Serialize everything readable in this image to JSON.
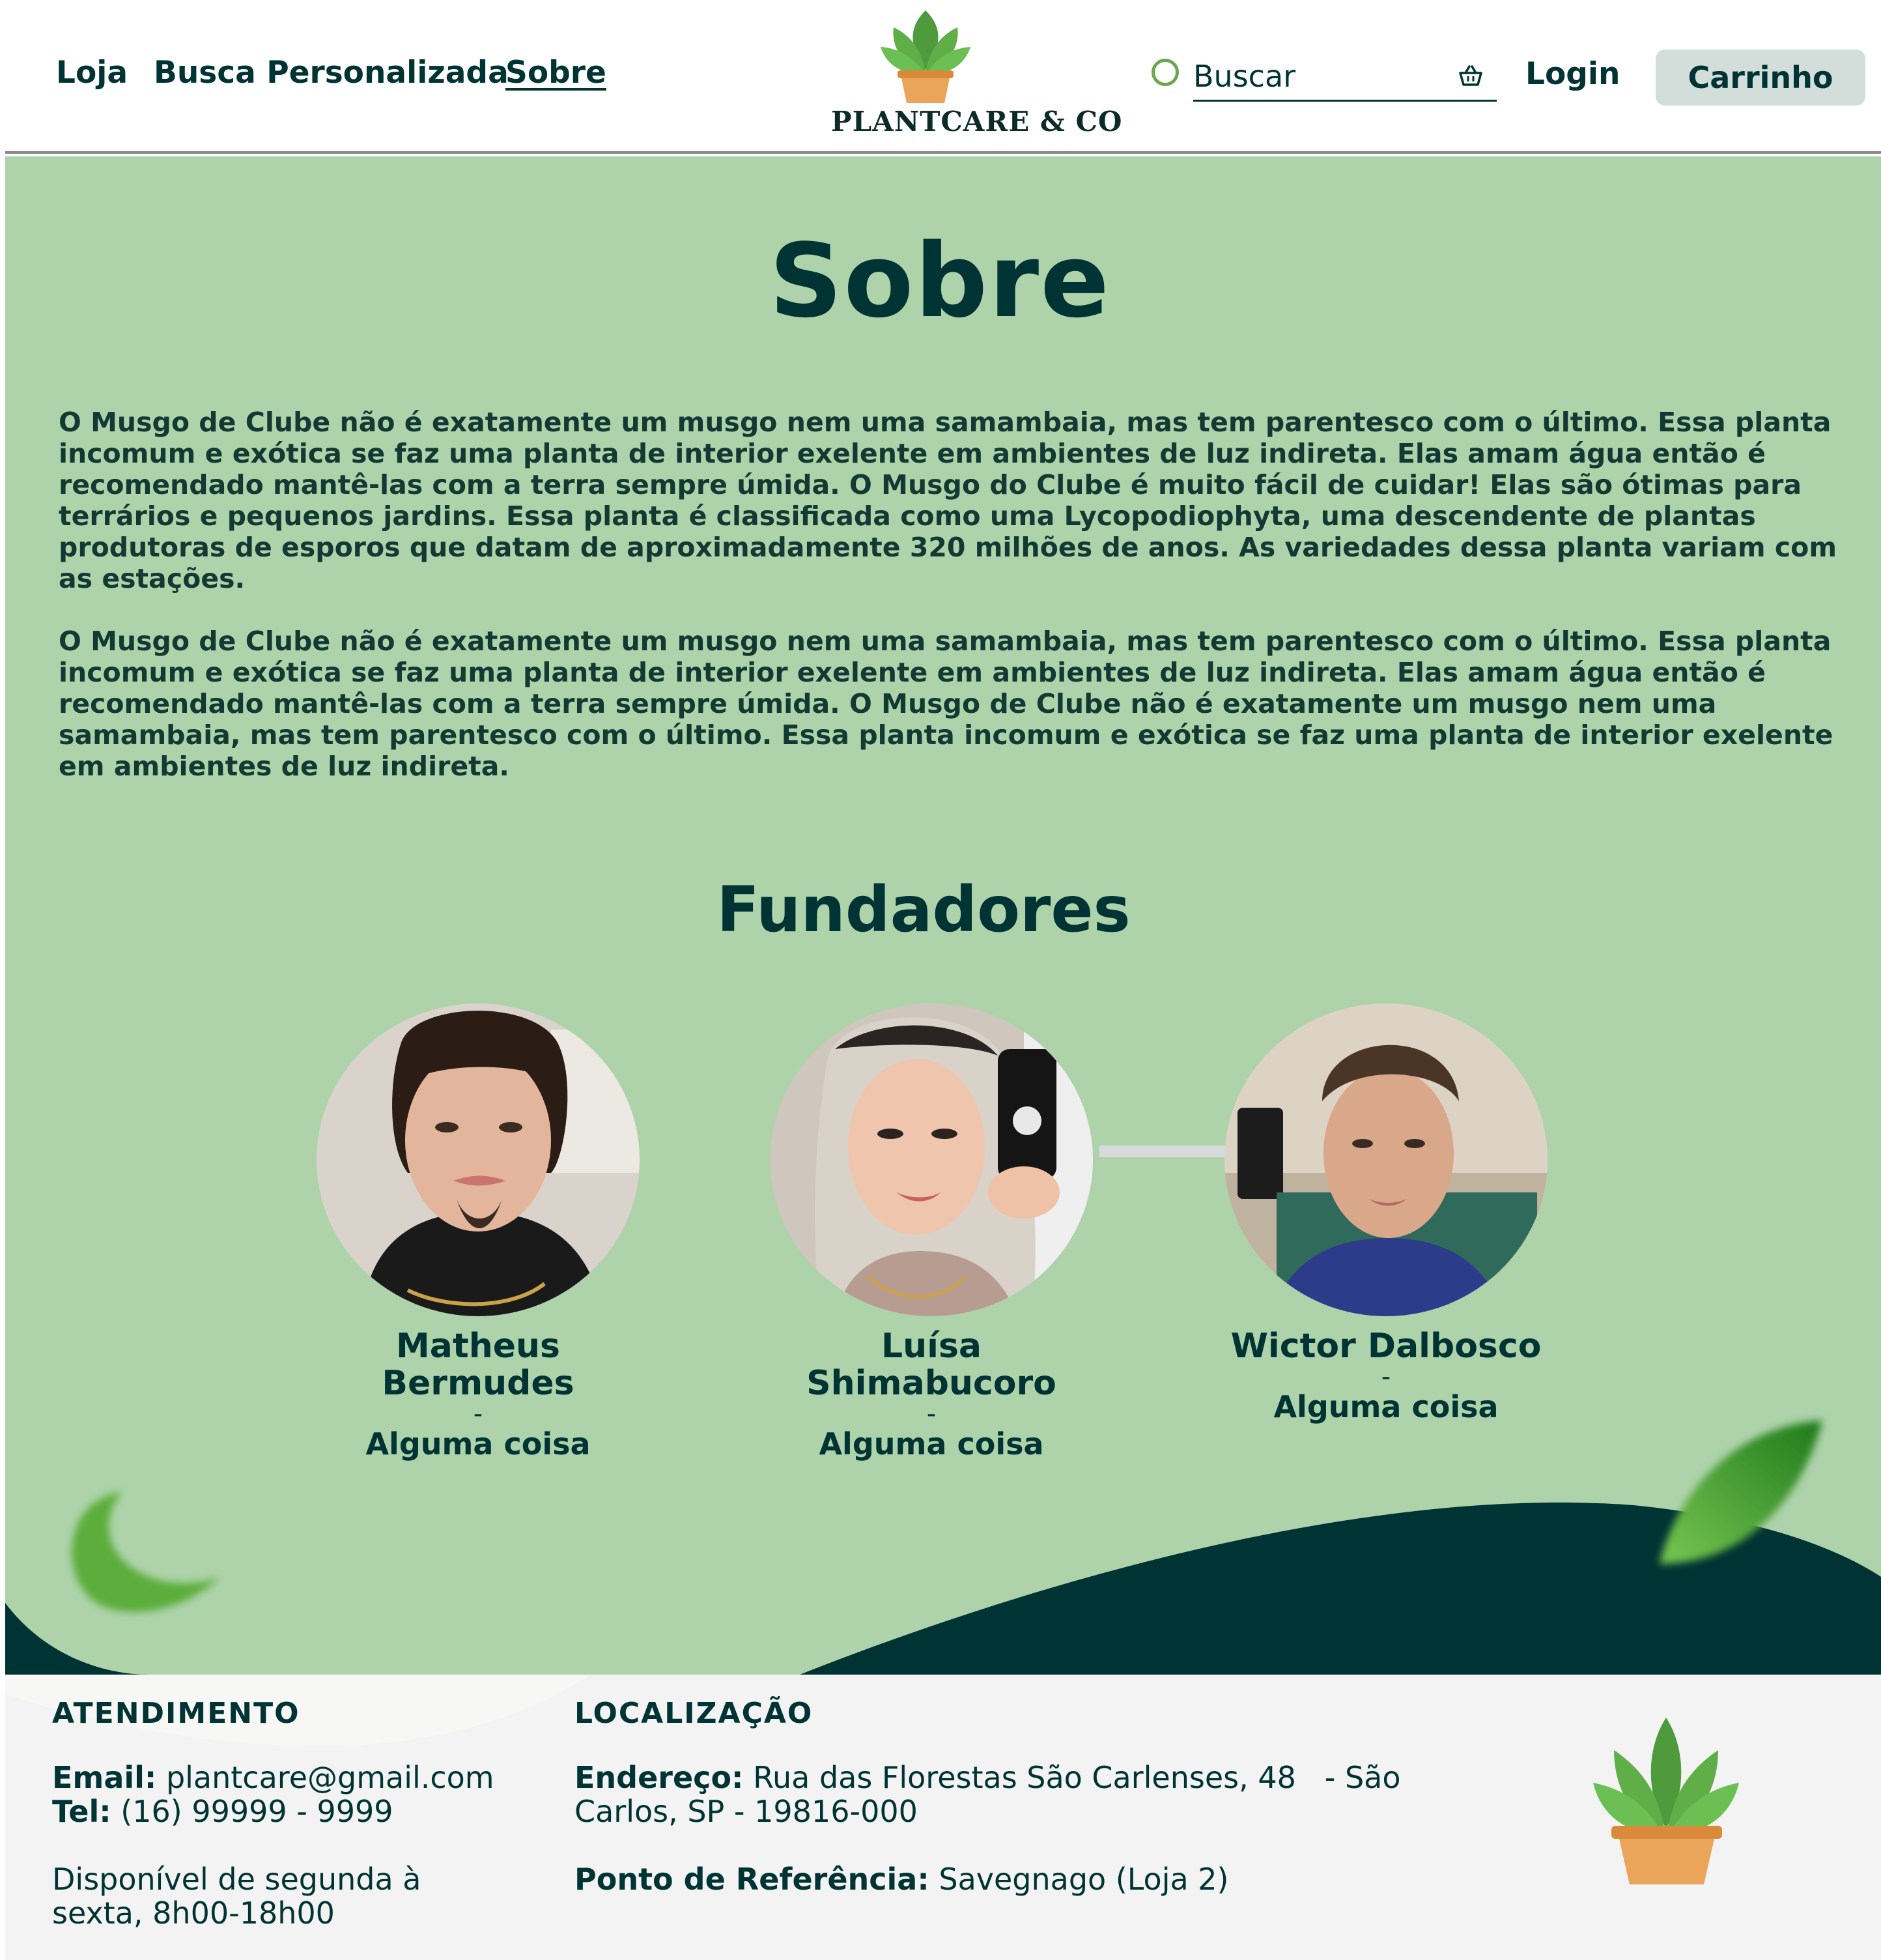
{
  "header": {
    "nav": [
      {
        "label": "Loja"
      },
      {
        "label": "Busca Personalizada"
      },
      {
        "label": "Sobre"
      }
    ],
    "logo_text": "PLANTCARE & CO",
    "search": {
      "placeholder": "Buscar"
    },
    "login_label": "Login",
    "cart_label": "Carrinho"
  },
  "main": {
    "title": "Sobre",
    "paragraphs": [
      "O Musgo de Clube não é exatamente um musgo nem uma samambaia, mas tem parentesco com o último. Essa planta incomum e exótica se faz uma planta de interior exelente em ambientes de luz indireta. Elas amam água então é recomendado mantê-las com a terra sempre úmida. O Musgo do Clube é muito fácil de cuidar! Elas são ótimas para terrários e pequenos jardins. Essa planta é classificada como uma Lycopodiophyta, uma descendente de plantas produtoras de esporos que datam de aproximadamente 320 milhões de anos. As variedades dessa planta variam com as estações.",
      "O Musgo de Clube não é exatamente um musgo nem uma samambaia, mas tem parentesco com o último. Essa planta incomum e exótica se faz uma planta de interior exelente em ambientes de luz indireta. Elas amam água então é recomendado mantê-las com a terra sempre úmida. O Musgo de Clube não é exatamente um musgo nem uma samambaia, mas tem parentesco com o último. Essa planta incomum e exótica se faz uma planta de interior exelente em ambientes de luz indireta."
    ],
    "founders_title": "Fundadores",
    "founders": [
      {
        "name": "Matheus Bermudes",
        "dash": "-",
        "role": "Alguma coisa"
      },
      {
        "name": "Luísa Shimabucoro",
        "dash": "-",
        "role": "Alguma coisa"
      },
      {
        "name": "Wictor Dalbosco",
        "dash": "-",
        "role": "Alguma coisa"
      }
    ]
  },
  "footer": {
    "atendimento": {
      "heading": "ATENDIMENTO",
      "email_label": "Email:",
      "email": "plantcare@gmail.com",
      "tel_label": "Tel:",
      "tel": "(16) 99999 - 9999",
      "hours": "Disponível de segunda à sexta, 8h00-18h00"
    },
    "localizacao": {
      "heading": "LOCALIZAÇÃO",
      "address_label": "Endereço:",
      "address": "Rua das Florestas São Carlenses, 48   - São Carlos, SP - 19816-000",
      "reference_label": "Ponto de Referência:",
      "reference": "Savegnago (Loja 2)"
    }
  },
  "colors": {
    "primary": "#003333",
    "background": "#aed3ab",
    "wave": "#003333",
    "footer_bg": "#f2f3f2",
    "cart_bg": "#d3dedb",
    "leaf": "#5aa046",
    "pot": "#e8a255"
  },
  "icons": [
    "plant-logo-icon",
    "search-circle-icon",
    "basket-icon",
    "plant-pot-icon",
    "leaf-decoration"
  ]
}
